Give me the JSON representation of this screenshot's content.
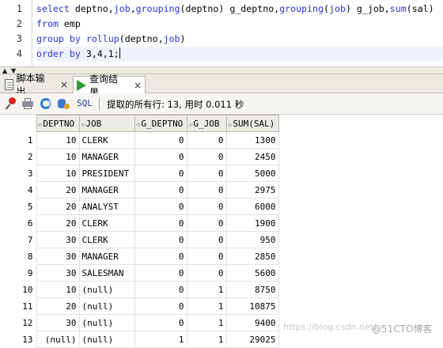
{
  "editor": {
    "line_numbers": [
      "1",
      "2",
      "3",
      "4"
    ],
    "lines": [
      [
        {
          "t": "select",
          "c": "kw"
        },
        {
          "t": " deptno,"
        },
        {
          "t": "job",
          "c": "kw"
        },
        {
          "t": ","
        },
        {
          "t": "grouping",
          "c": "fn"
        },
        {
          "t": "(deptno) g_deptno,"
        },
        {
          "t": "grouping",
          "c": "fn"
        },
        {
          "t": "("
        },
        {
          "t": "job",
          "c": "kw"
        },
        {
          "t": ") g_job,"
        },
        {
          "t": "sum",
          "c": "fn"
        },
        {
          "t": "(sal)"
        }
      ],
      [
        {
          "t": "from",
          "c": "kw"
        },
        {
          "t": " emp"
        }
      ],
      [
        {
          "t": "group",
          "c": "kw"
        },
        {
          "t": " "
        },
        {
          "t": "by",
          "c": "kw"
        },
        {
          "t": " "
        },
        {
          "t": "rollup",
          "c": "fn"
        },
        {
          "t": "(deptno,"
        },
        {
          "t": "job",
          "c": "kw"
        },
        {
          "t": ")"
        }
      ],
      [
        {
          "t": "order",
          "c": "kw"
        },
        {
          "t": " "
        },
        {
          "t": "by",
          "c": "kw"
        },
        {
          "t": " 3,4,1;"
        }
      ]
    ]
  },
  "tabs": [
    {
      "label": "脚本输出",
      "icon": "document-icon",
      "active": false
    },
    {
      "label": "查询结果",
      "icon": "run-icon",
      "active": true
    }
  ],
  "toolbar": {
    "sql_label": "SQL",
    "status": "提取的所有行: 13, 用时 0.011 秒"
  },
  "grid": {
    "columns": [
      "DEPTNO",
      "JOB",
      "G_DEPTNO",
      "G_JOB",
      "SUM(SAL)"
    ],
    "rows": [
      [
        "1",
        "10",
        "CLERK",
        "0",
        "0",
        "1300"
      ],
      [
        "2",
        "10",
        "MANAGER",
        "0",
        "0",
        "2450"
      ],
      [
        "3",
        "10",
        "PRESIDENT",
        "0",
        "0",
        "5000"
      ],
      [
        "4",
        "20",
        "MANAGER",
        "0",
        "0",
        "2975"
      ],
      [
        "5",
        "20",
        "ANALYST",
        "0",
        "0",
        "6000"
      ],
      [
        "6",
        "20",
        "CLERK",
        "0",
        "0",
        "1900"
      ],
      [
        "7",
        "30",
        "CLERK",
        "0",
        "0",
        "950"
      ],
      [
        "8",
        "30",
        "MANAGER",
        "0",
        "0",
        "2850"
      ],
      [
        "9",
        "30",
        "SALESMAN",
        "0",
        "0",
        "5600"
      ],
      [
        "10",
        "10",
        "(null)",
        "0",
        "1",
        "8750"
      ],
      [
        "11",
        "20",
        "(null)",
        "0",
        "1",
        "10875"
      ],
      [
        "12",
        "30",
        "(null)",
        "0",
        "1",
        "9400"
      ],
      [
        "13",
        "(null)",
        "(null)",
        "1",
        "1",
        "29025"
      ]
    ]
  },
  "watermark": {
    "left": "https://blog.csdn.net/",
    "right": "@51CTO博客"
  }
}
